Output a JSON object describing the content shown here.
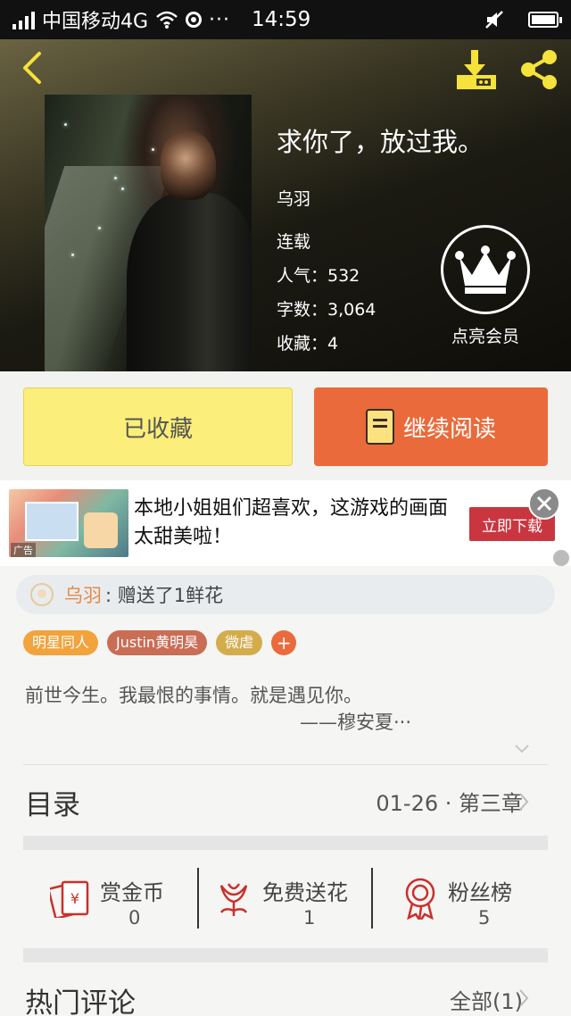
{
  "status_bar": {
    "carrier": "中国移动4G",
    "dots": "···",
    "time": "14:59"
  },
  "book": {
    "title": "求你了，放过我。",
    "author": "乌羽",
    "status": "连载",
    "popularity": "人气：532",
    "word_count": "字数：3,064",
    "favorites": "收藏：4"
  },
  "vip": {
    "label": "点亮会员"
  },
  "actions": {
    "collected_label": "已收藏",
    "continue_label": "继续阅读"
  },
  "ad": {
    "text": "本地小姐姐们超喜欢，这游戏的画面太甜美啦！",
    "cta": "立即下载",
    "tag": "广告"
  },
  "gift": {
    "user": "乌羽",
    "message": ": 赠送了1鲜花"
  },
  "tags": [
    {
      "label": "明星同人",
      "color": "#f2a33b"
    },
    {
      "label": "Justin黄明昊",
      "color": "#c96d55"
    },
    {
      "label": "微虐",
      "color": "#d3ad4c"
    }
  ],
  "tag_add": "+",
  "description": {
    "line1": "前世今生。我最恨的事情。就是遇见你。",
    "line2": "——穆安夏···"
  },
  "toc": {
    "title": "目录",
    "latest": "01-26 · 第三章"
  },
  "stats": [
    {
      "label": "赏金币",
      "value": "0",
      "icon": "red-envelope-icon"
    },
    {
      "label": "免费送花",
      "value": "1",
      "icon": "flower-icon"
    },
    {
      "label": "粉丝榜",
      "value": "5",
      "icon": "medal-icon"
    }
  ],
  "comments": {
    "title": "热门评论",
    "all": "全部(1)"
  },
  "colors": {
    "accent_orange": "#ea6a3b",
    "collected_yellow": "#fbee7a",
    "icon_yellow": "#f5e23a",
    "icon_red": "#c9302c"
  }
}
